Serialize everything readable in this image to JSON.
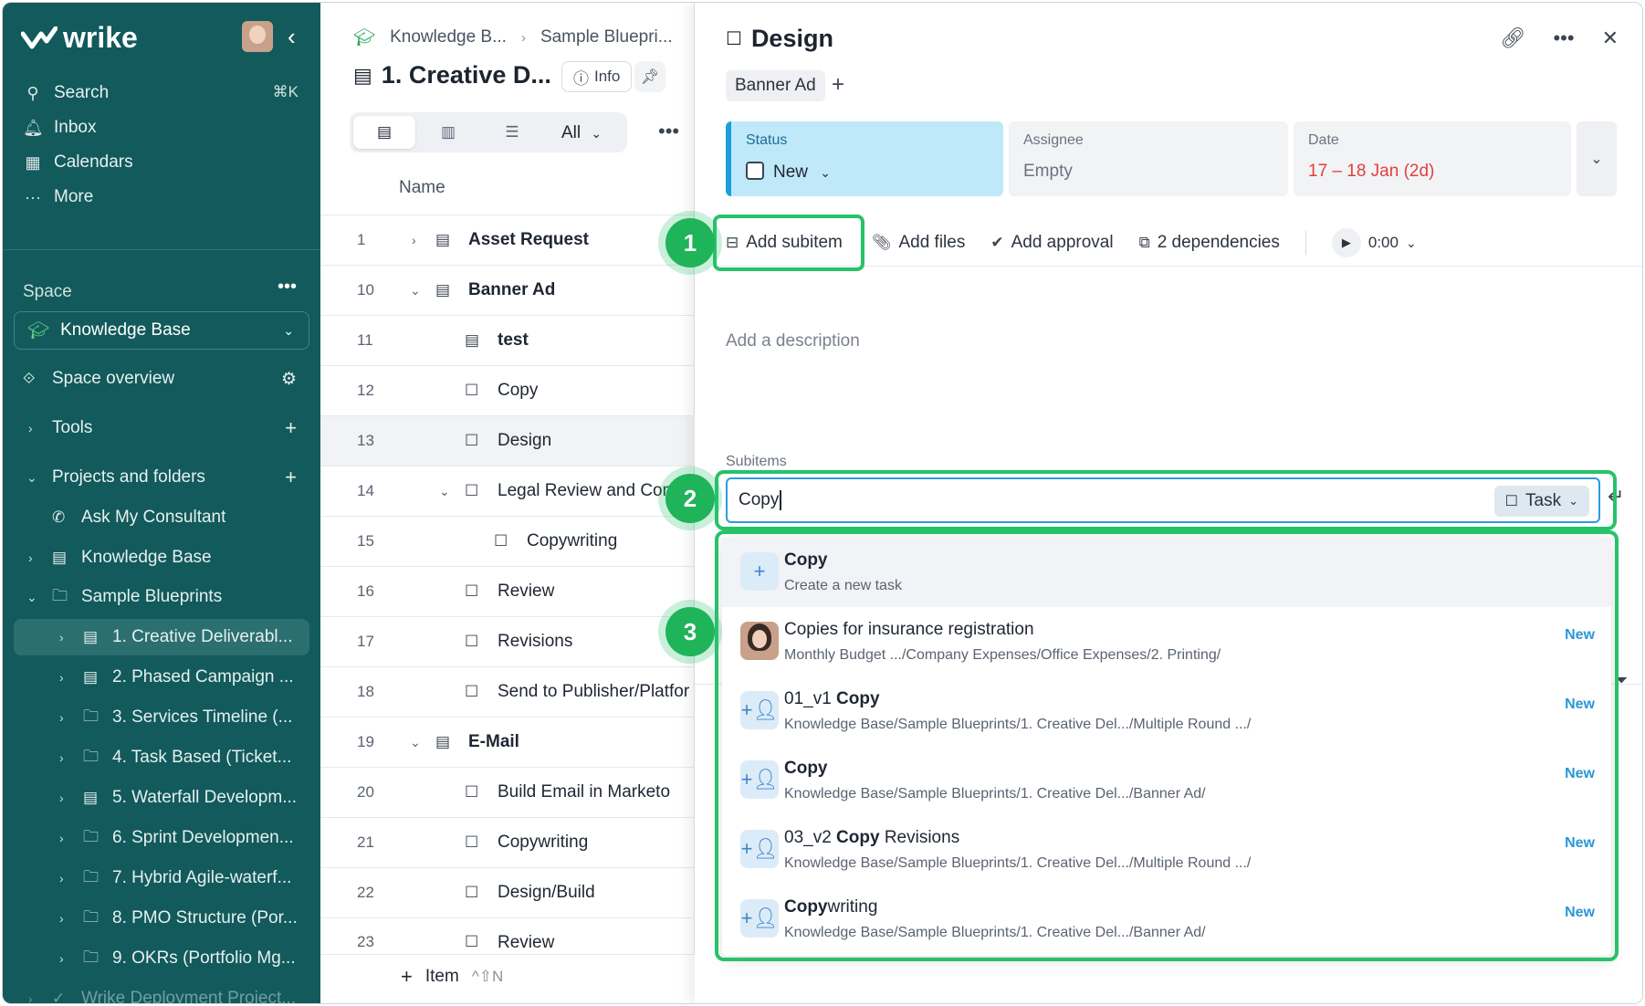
{
  "app": {
    "brand": "wrike"
  },
  "sidebar": {
    "nav": [
      {
        "label": "Search",
        "icon": "search-icon",
        "shortcut": "⌘K"
      },
      {
        "label": "Inbox",
        "icon": "bell-icon"
      },
      {
        "label": "Calendars",
        "icon": "calendar-icon"
      },
      {
        "label": "More",
        "icon": "more-icon"
      }
    ],
    "space_label": "Space",
    "space_select": "Knowledge Base",
    "space_overview": "Space overview",
    "tools": "Tools",
    "projects_and_folders": "Projects and folders",
    "tree": [
      {
        "label": "Ask My Consultant"
      },
      {
        "label": "Knowledge Base"
      },
      {
        "label": "Sample Blueprints"
      },
      {
        "label": "1. Creative Deliverabl..."
      },
      {
        "label": "2. Phased Campaign ..."
      },
      {
        "label": "3. Services Timeline (..."
      },
      {
        "label": "4. Task Based (Ticket..."
      },
      {
        "label": "5. Waterfall Developm..."
      },
      {
        "label": "6. Sprint Developmen..."
      },
      {
        "label": "7. Hybrid Agile-waterf..."
      },
      {
        "label": "8. PMO Structure (Por..."
      },
      {
        "label": "9. OKRs (Portfolio Mg..."
      },
      {
        "label": "Wrike Deployment Project..."
      }
    ]
  },
  "list": {
    "breadcrumb": [
      "Knowledge B...",
      "Sample Bluepri..."
    ],
    "title": "1. Creative D...",
    "info_label": "Info",
    "view_filter": "All",
    "column_name": "Name",
    "rows": [
      {
        "num": "1",
        "label": "Asset Request"
      },
      {
        "num": "10",
        "label": "Banner Ad"
      },
      {
        "num": "11",
        "label": "test"
      },
      {
        "num": "12",
        "label": "Copy"
      },
      {
        "num": "13",
        "label": "Design"
      },
      {
        "num": "14",
        "label": "Legal Review and Com"
      },
      {
        "num": "15",
        "label": "Copywriting"
      },
      {
        "num": "16",
        "label": "Review"
      },
      {
        "num": "17",
        "label": "Revisions"
      },
      {
        "num": "18",
        "label": "Send to Publisher/Platfor"
      },
      {
        "num": "19",
        "label": "E-Mail"
      },
      {
        "num": "20",
        "label": "Build Email in Marketo"
      },
      {
        "num": "21",
        "label": "Copywriting"
      },
      {
        "num": "22",
        "label": "Design/Build"
      },
      {
        "num": "23",
        "label": "Review"
      }
    ],
    "add_item": "Item",
    "add_item_shortcut": "^⇧N"
  },
  "detail": {
    "title": "Design",
    "tag": "Banner Ad",
    "status_label": "Status",
    "status_value": "New",
    "assignee_label": "Assignee",
    "assignee_value": "Empty",
    "date_label": "Date",
    "date_value": "17 – 18 Jan (2d)",
    "toolbar": {
      "add_subitem": "Add subitem",
      "add_files": "Add files",
      "add_approval": "Add approval",
      "dependencies": "2 dependencies",
      "timer": "0:00"
    },
    "description_placeholder": "Add a description",
    "subitems_label": "Subitems",
    "subitem_input": "Copy",
    "type_button": "Task",
    "suggestions": [
      {
        "title_pre": "",
        "title_bold": "Copy",
        "title_post": "",
        "sub": "Create a new task",
        "new": ""
      },
      {
        "title_pre": "Copies for insurance registration",
        "title_bold": "",
        "title_post": "",
        "sub": "Monthly Budget .../Company Expenses/Office Expenses/2. Printing/",
        "new": "New"
      },
      {
        "title_pre": "01_v1 ",
        "title_bold": "Copy",
        "title_post": "",
        "sub": "Knowledge Base/Sample Blueprints/1. Creative Del.../Multiple Round .../",
        "new": "New"
      },
      {
        "title_pre": "",
        "title_bold": "Copy",
        "title_post": "",
        "sub": "Knowledge Base/Sample Blueprints/1. Creative Del.../Banner Ad/",
        "new": "New"
      },
      {
        "title_pre": "03_v2 ",
        "title_bold": "Copy",
        "title_post": " Revisions",
        "sub": "Knowledge Base/Sample Blueprints/1. Creative Del.../Multiple Round .../",
        "new": "New"
      },
      {
        "title_pre": "",
        "title_bold": "Copy",
        "title_post": "writing",
        "sub": "Knowledge Base/Sample Blueprints/1. Creative Del.../Banner Ad/",
        "new": "New"
      }
    ]
  },
  "callouts": [
    "1",
    "2",
    "3"
  ],
  "colors": {
    "sidebar": "#125a5c",
    "highlight": "#27c26a",
    "accent": "#2c96d8",
    "status_bg": "#bfe8f9",
    "date": "#e0403d"
  }
}
